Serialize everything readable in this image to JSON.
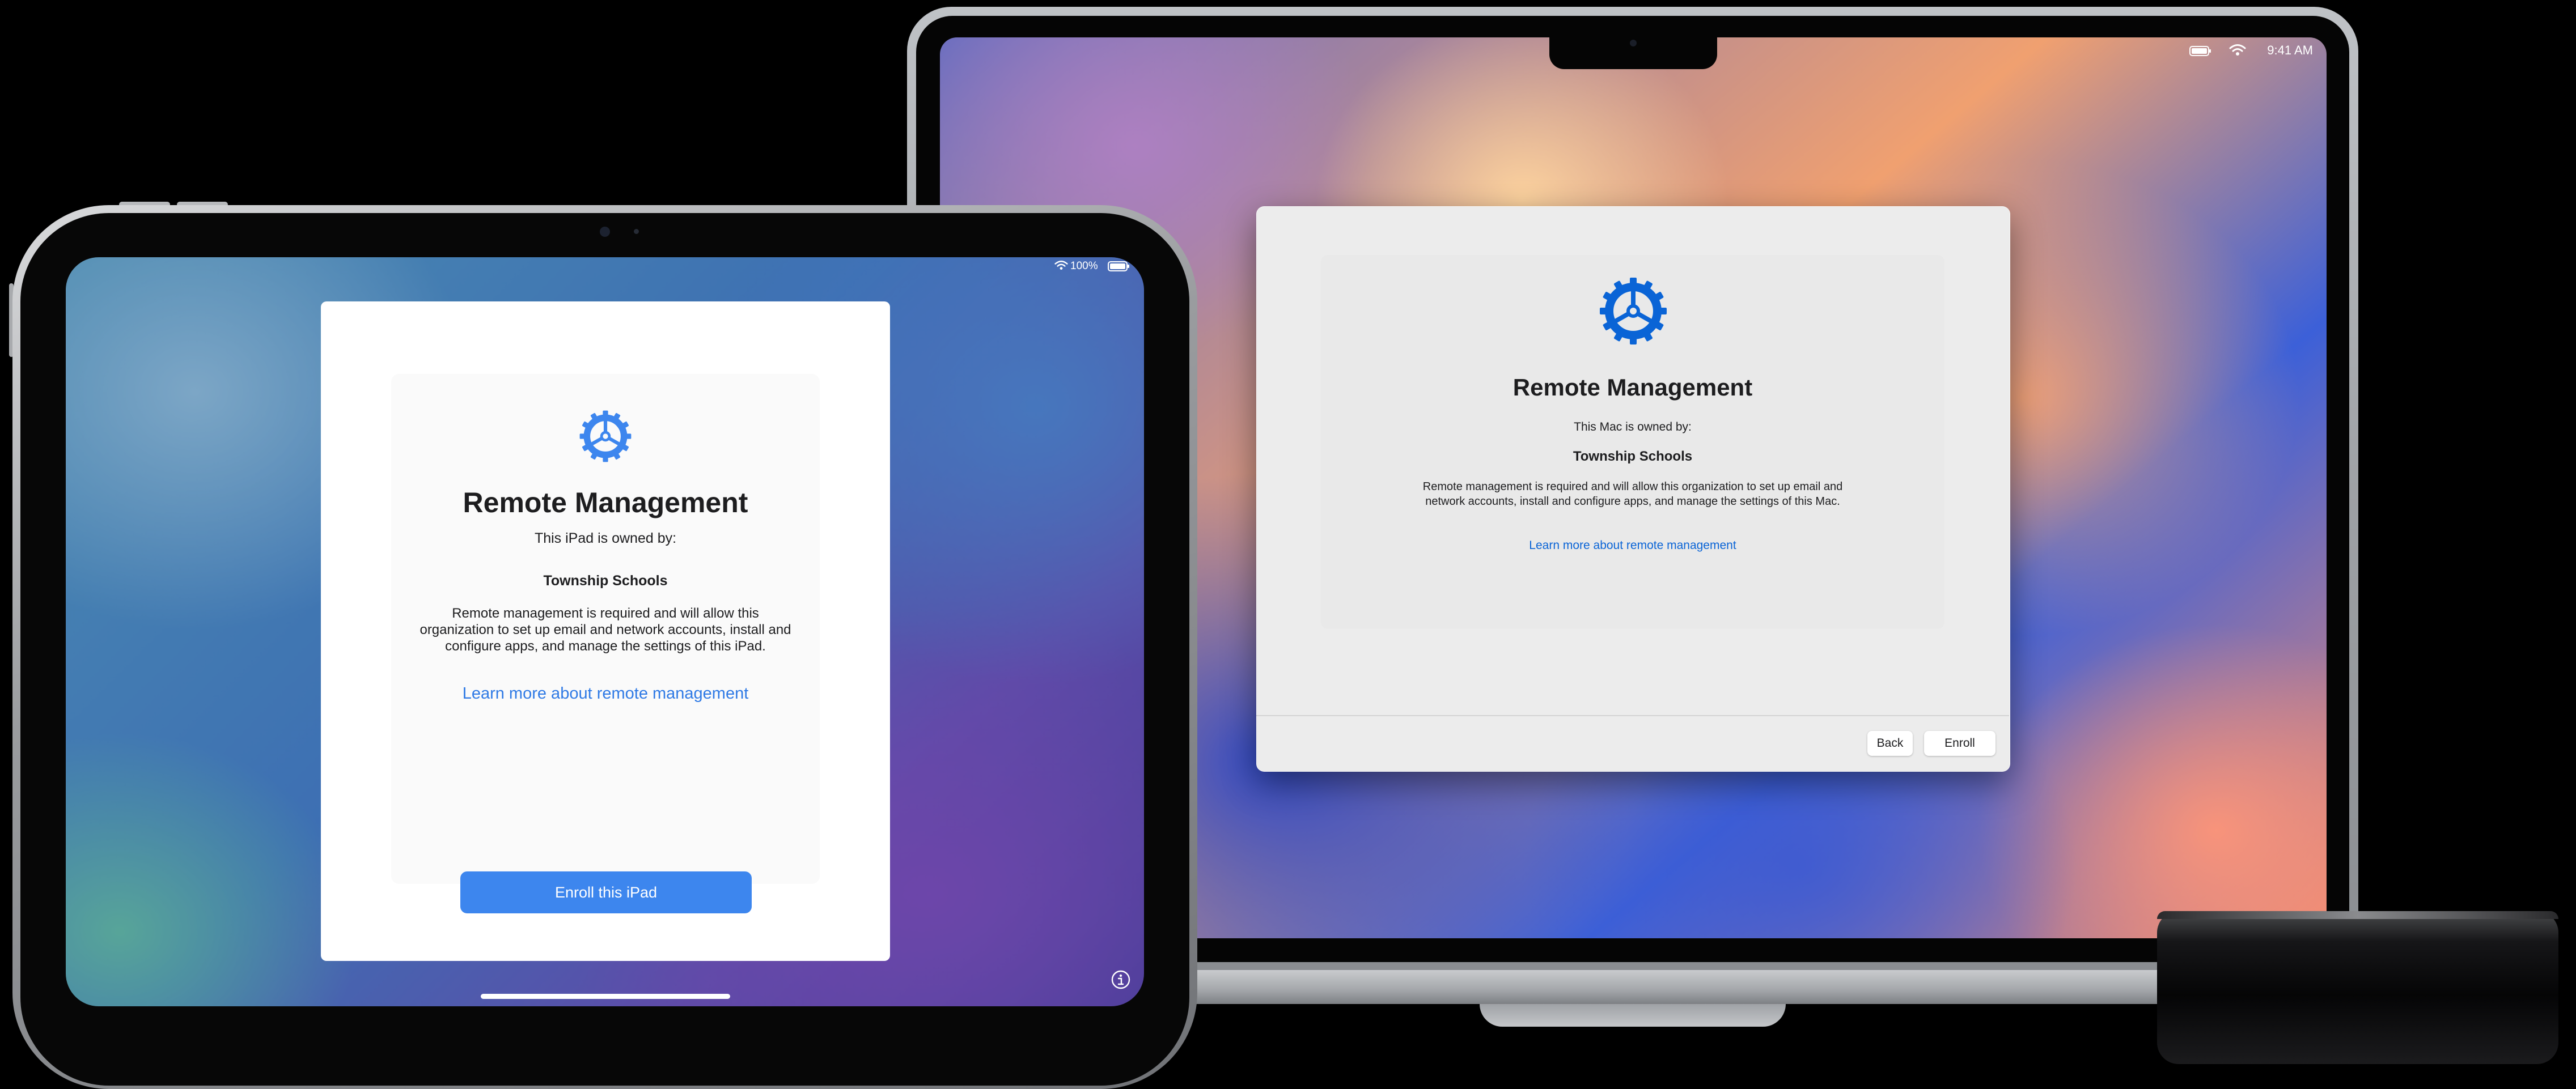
{
  "mac": {
    "status_time": "9:41 AM",
    "dialog": {
      "title": "Remote Management",
      "owned_by": "This Mac is owned by:",
      "organization": "Township Schools",
      "description": "Remote management is required and will allow this organization to set up email and network accounts, install and configure apps, and manage the settings of this Mac.",
      "learn_more": "Learn more about remote management",
      "back_label": "Back",
      "enroll_label": "Enroll"
    }
  },
  "ipad": {
    "battery": "100%",
    "card": {
      "title": "Remote Management",
      "owned_by": "This iPad is owned by:",
      "organization": "Township Schools",
      "description": "Remote management is required and will allow this organization to set up email and network accounts, install and configure apps, and manage the settings of this iPad.",
      "learn_more": "Learn more about remote management",
      "enroll_label": "Enroll this iPad"
    }
  },
  "colors": {
    "mac_gear": "#0a64d6",
    "mac_link": "#0a64d6",
    "ipad_gear": "#3d86ee",
    "ipad_link": "#2f7ae5",
    "ipad_enroll_button": "#3d86ee"
  },
  "icons": {
    "gear": "gear-icon",
    "wifi": "wifi-icon",
    "battery": "battery-icon",
    "info": "info-icon"
  }
}
